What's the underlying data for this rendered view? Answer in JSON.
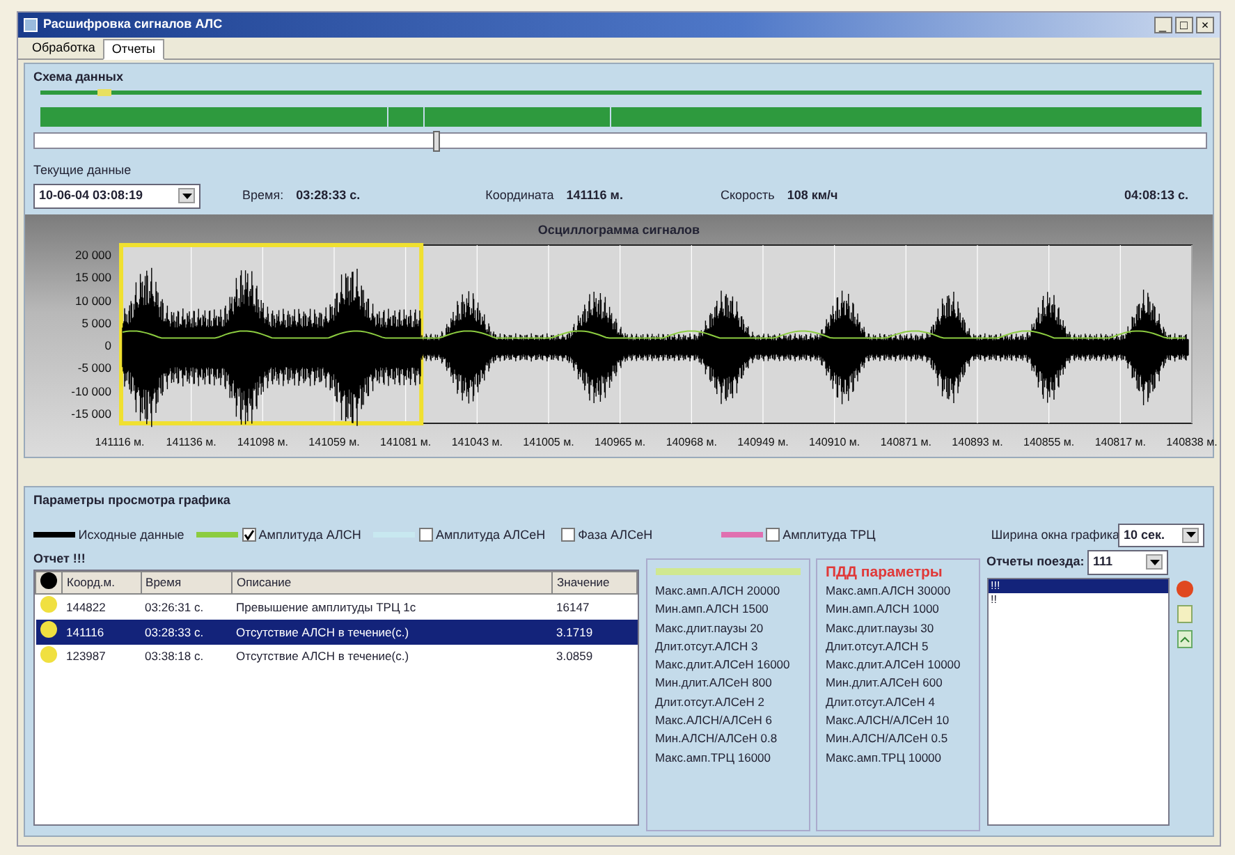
{
  "window": {
    "title": "Расшифровка сигналов АЛС",
    "controls": [
      "_",
      "□",
      "×"
    ]
  },
  "tabs": [
    {
      "label": "Обработка",
      "selected": false
    },
    {
      "label": "Отчеты",
      "selected": true
    }
  ],
  "data_scheme": {
    "title": "Схема данных",
    "position_marker": {
      "level": 0.05
    },
    "slider": {
      "level": 0.34
    }
  },
  "current_data": {
    "label": "Текущие данные",
    "date_select": "10-06-04 03:08:19",
    "time_label": "Время:",
    "time_value": "03:28:33 с.",
    "coord_label": "Координата",
    "coord_value": "141116 м.",
    "speed_label": "Скорость",
    "speed_value": "108 км/ч",
    "total_time": "04:08:13 с."
  },
  "oscillogram": {
    "title": "Осциллограмма сигналов",
    "window": {
      "level": 0.28
    },
    "y_labels": [
      "20 000",
      "15 000",
      "10 000",
      "5 000",
      "0",
      "-5 000",
      "-10 000",
      "-15 000"
    ],
    "x_labels": [
      "141116 м.",
      "141136 м.",
      "141098 м.",
      "141059 м.",
      "141081 м.",
      "141043 м.",
      "141005 м.",
      "140965 м.",
      "140968 м.",
      "140949 м.",
      "140910 м.",
      "140871 м.",
      "140893 м.",
      "140855 м.",
      "140817 м.",
      "140838 м."
    ]
  },
  "view_params": {
    "title": "Параметры просмотра графика",
    "legend": [
      {
        "kind": "plain",
        "label": "Исходные данные",
        "color": "#000000"
      },
      {
        "kind": "check",
        "label": "Амплитуда АЛСН",
        "color": "#8ccc40",
        "checked": true
      },
      {
        "kind": "check",
        "label": "Амплитуда АЛСеН",
        "color": "#c8e8f0",
        "checked": false
      },
      {
        "kind": "check",
        "label": "Фаза АЛСеН",
        "checked": false
      },
      {
        "kind": "check",
        "label": "Амплитуда ТРЦ",
        "color": "#e070b0",
        "checked": false
      }
    ],
    "window_width_label": "Ширина окна графика",
    "window_width": "10 сек."
  },
  "report": {
    "title": "Отчет !!!",
    "columns": [
      "Коорд.м.",
      "Время",
      "Описание",
      "Значение"
    ],
    "rows": [
      {
        "color": "#f0e040",
        "selected": false,
        "cells": [
          "144822",
          "03:26:31 с.",
          "Превышение амплитуды ТРЦ 1с",
          "16147"
        ]
      },
      {
        "color": "#f0e040",
        "selected": true,
        "cells": [
          "141116",
          "03:28:33 с.",
          "Отсутствие АЛСН в течение(с.)",
          "3.1719"
        ]
      },
      {
        "color": "#f0e040",
        "selected": false,
        "cells": [
          "123987",
          "03:38:18 с.",
          "Отсутствие АЛСН в течение(с.)",
          "3.0859"
        ]
      }
    ]
  },
  "param_sets": [
    {
      "kind": "bar",
      "color": "#d0e890",
      "items": [
        "Макс.амп.АЛСН 20000",
        "Мин.амп.АЛСН 1500",
        "Макс.длит.паузы 20",
        "Длит.отсут.АЛСН 3",
        "Макс.длит.АЛСеН 16000",
        "Мин.длит.АЛСеН 800",
        "Длит.отсут.АЛСеН 2",
        "Макс.АЛСН/АЛСеН 6",
        "Мин.АЛСН/АЛСеН 0.8",
        "Макс.амп.ТРЦ 16000"
      ]
    },
    {
      "kind": "titled",
      "title": "ПДД параметры",
      "color": "#e03838",
      "items": [
        "Макс.амп.АЛСН 30000",
        "Мин.амп.АЛСН 1000",
        "Макс.длит.паузы 30",
        "Длит.отсут.АЛСН 5",
        "Макс.длит.АЛСеН 10000",
        "Мин.длит.АЛСеН 600",
        "Длит.отсут.АЛСеН 4",
        "Макс.АЛСН/АЛСеН 10",
        "Мин.АЛСН/АЛСеН 0.5",
        "Макс.амп.ТРЦ 10000"
      ]
    }
  ],
  "train_reports": {
    "label": "Отчеты поезда:",
    "select": "111",
    "items": [
      {
        "label": "!!!",
        "selected": true
      },
      {
        "label": "!!",
        "selected": false
      }
    ]
  }
}
